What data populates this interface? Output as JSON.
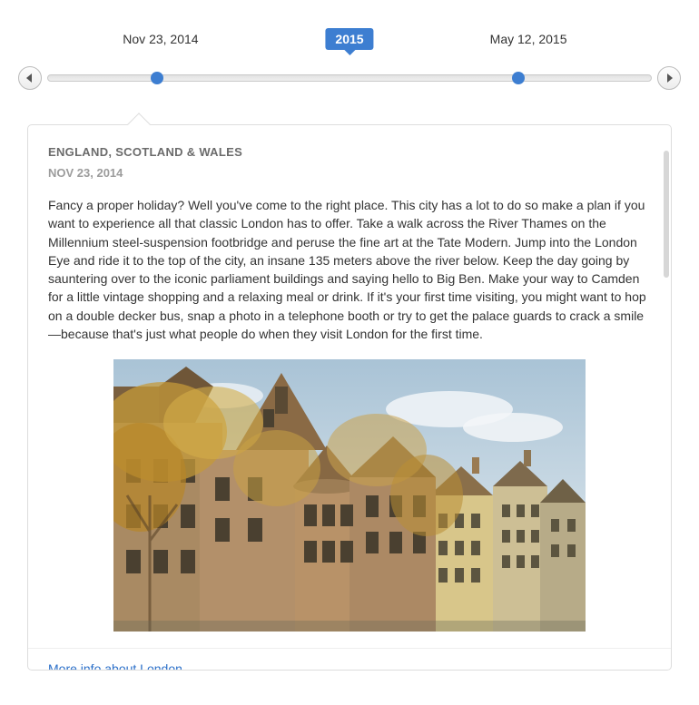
{
  "timeline": {
    "prev_aria": "Previous",
    "next_aria": "Next",
    "year_badge": "2015",
    "points": [
      {
        "label": "Nov 23, 2014",
        "position_pct": 18
      },
      {
        "label": "May 12, 2015",
        "position_pct": 78
      }
    ]
  },
  "card": {
    "title": "ENGLAND, SCOTLAND & WALES",
    "subtitle": "NOV 23, 2014",
    "body": "Fancy a proper holiday? Well you've come to the right place. This city has a lot to do so make a plan if you want to experience all that classic London has to offer. Take a walk across the River Thames on the Millennium steel-suspension footbridge and peruse the fine art at the Tate Modern. Jump into the London Eye and ride it to the top of the city, an insane 135 meters above the river below. Keep the day going by sauntering over to the iconic parliament buildings and saying hello to Big Ben. Make your way to Camden for a little vintage shopping and a relaxing meal or drink. If it's your first time visiting, you might want to hop on a double decker bus, snap a photo in a telephone booth or try to get the palace guards to crack a smile—because that's just what people do when they visit London for the first time.",
    "link_label": "More info about London"
  }
}
